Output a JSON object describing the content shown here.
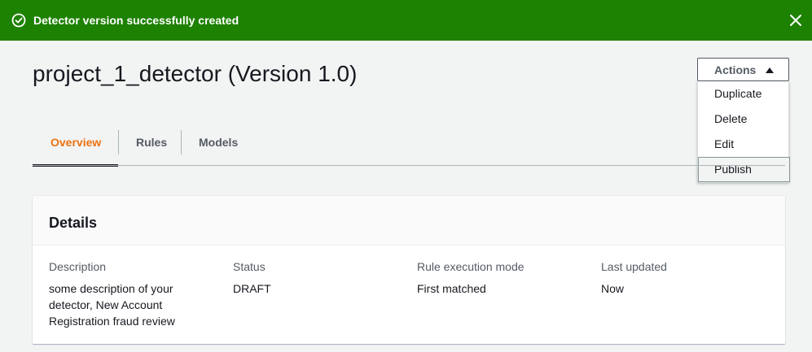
{
  "flash": {
    "message": "Detector version successfully created",
    "icon": "check-circle-icon",
    "close_icon": "close-icon",
    "color": "#1d8102"
  },
  "page": {
    "title": "project_1_detector (Version 1.0)"
  },
  "actions": {
    "label": "Actions",
    "caret_icon": "caret-up-icon",
    "items": [
      {
        "label": "Duplicate"
      },
      {
        "label": "Delete"
      },
      {
        "label": "Edit"
      },
      {
        "label": "Publish",
        "hovered": true
      }
    ]
  },
  "tabs": [
    {
      "label": "Overview",
      "active": true
    },
    {
      "label": "Rules",
      "active": false
    },
    {
      "label": "Models",
      "active": false
    }
  ],
  "details": {
    "title": "Details",
    "fields": [
      {
        "label": "Description",
        "value": "some description of your detector, New Account Registration fraud review"
      },
      {
        "label": "Status",
        "value": "DRAFT"
      },
      {
        "label": "Rule execution mode",
        "value": "First matched"
      },
      {
        "label": "Last updated",
        "value": "Now"
      }
    ]
  },
  "colors": {
    "accent": "#ec7211",
    "success": "#1d8102",
    "background": "#f2f3f3"
  }
}
